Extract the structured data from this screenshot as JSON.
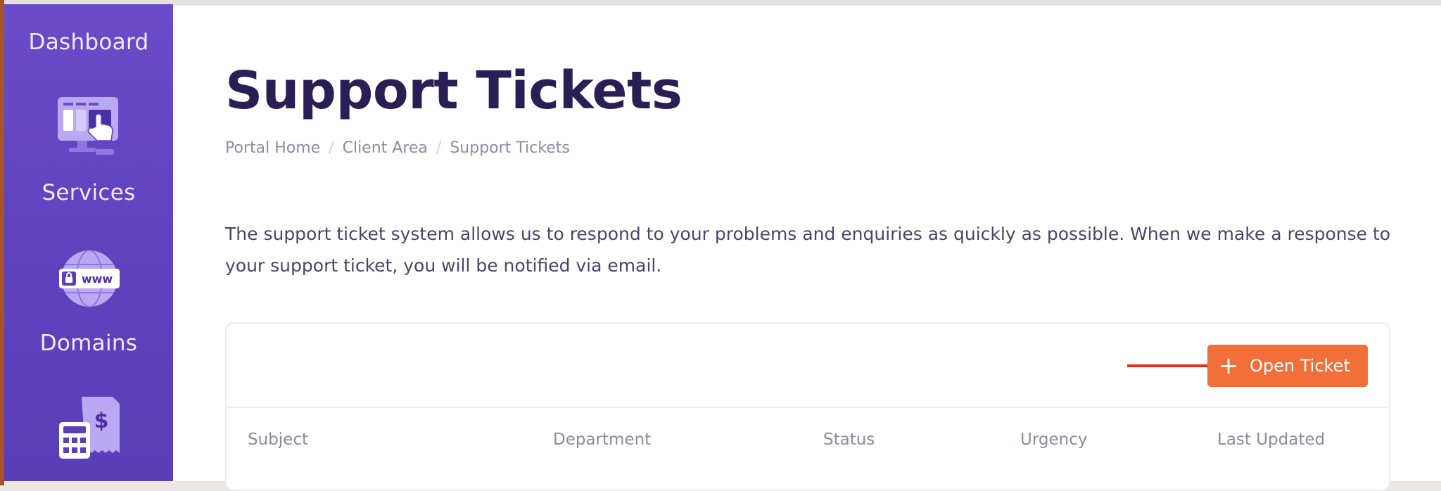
{
  "sidebar": {
    "items": [
      {
        "label": "Dashboard",
        "icon": "dashboard-icon"
      },
      {
        "label": "Services",
        "icon": "services-monitor-icon"
      },
      {
        "label": "Domains",
        "icon": "domains-globe-www-icon"
      },
      {
        "label": "",
        "icon": "billing-calculator-invoice-icon"
      }
    ],
    "domain_badge_text": "www",
    "billing_symbol": "$"
  },
  "page": {
    "title": "Support Tickets",
    "breadcrumb": [
      "Portal Home",
      "Client Area",
      "Support Tickets"
    ],
    "intro": "The support ticket system allows us to respond to your problems and enquiries as quickly as possible. When we make a response to your support ticket, you will be notified via email."
  },
  "tickets": {
    "open_button_label": "Open Ticket",
    "open_button_icon": "plus-icon",
    "columns": [
      "Subject",
      "Department",
      "Status",
      "Urgency",
      "Last Updated"
    ]
  },
  "colors": {
    "sidebar": "#6a4cc8",
    "title": "#2a1f55",
    "accent_button": "#f36f3a",
    "annotation_arrow": "#e8301c"
  }
}
